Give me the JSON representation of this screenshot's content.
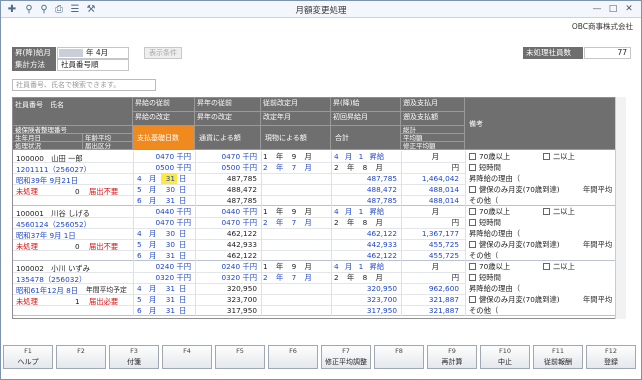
{
  "window": {
    "title": "月額変更処理",
    "company": "OBC商事株式会社"
  },
  "toolbar": {
    "icons": [
      "add-person-icon",
      "search-icon",
      "zoom-icon",
      "print-icon",
      "list-icon",
      "tools-icon"
    ]
  },
  "filters": {
    "month_label": "昇(降)給月",
    "month_value": "年 4月",
    "method_label": "集計方法",
    "method_value": "社員番号順",
    "display_button": "表示条件",
    "unprocessed_label": "未処理社員数",
    "unprocessed_value": "77"
  },
  "search": {
    "placeholder": "社員番号、氏名で検索できます。"
  },
  "table_header": {
    "emp_no": "社員番号",
    "name": "氏名",
    "insured_no": "被保険者整理番号",
    "birth": "生年月日",
    "status": "処理状況",
    "age": "年齢平均",
    "sep": "届出区分",
    "pay_before": "昇給の従前",
    "pay_after": "昇給の改定",
    "std_before": "昇年の従前",
    "std_after": "昇年の改定",
    "period_before": "従前改定月",
    "period_after": "改定年月",
    "raise_month": "昇(降)給",
    "raise_diff": "初回昇給月",
    "retro_pay": "遡及支払月",
    "retro_diff": "遡及支払額",
    "total": "総計",
    "avg": "平均額",
    "corrected": "修正平均額",
    "notes": "備考",
    "pay_days": "支払基礎日数",
    "by_pay": "通貨による額",
    "by_goods": "現物による額",
    "sum": "合計"
  },
  "employees": [
    {
      "emp_no": "100000",
      "name": "山田 一郎",
      "insured": "1201111（256027）",
      "birth": "昭和39年 9月21日",
      "status": "未処理",
      "status_num": "0",
      "notify": "届出不要",
      "age_avg": "",
      "pay_before": "0470 千円",
      "pay_after": "0500 千円",
      "std_before": "0470 千円",
      "std_after": "0500 千円",
      "prev_rev": [
        "1",
        "年",
        "9",
        "月"
      ],
      "new_rev": [
        "2",
        "年",
        "7",
        "月"
      ],
      "raise": [
        "4",
        "月",
        "1",
        "昇給"
      ],
      "first": [
        "2",
        "年",
        "8",
        "月"
      ],
      "retro": "月",
      "retro_amt": "円",
      "months": [
        {
          "m": "4",
          "d": "31",
          "cash": "487,785",
          "goods": "",
          "sum": "487,785",
          "total": "1,464,042"
        },
        {
          "m": "5",
          "d": "30",
          "cash": "488,472",
          "goods": "",
          "sum": "488,472",
          "total": "488,014"
        },
        {
          "m": "6",
          "d": "31",
          "cash": "487,785",
          "goods": "",
          "sum": "487,785",
          "total": "488,014"
        }
      ],
      "notes": [
        "70歳以上",
        "二以上",
        "短時間",
        "昇降給の理由（",
        "健保のみ月変(70歳到達)",
        "その他（"
      ],
      "notes_right": [
        "年間平均"
      ]
    },
    {
      "emp_no": "100001",
      "name": "川谷 しげる",
      "insured": "4560124（256052）",
      "birth": "昭和37年 9月 1日",
      "status": "未処理",
      "status_num": "0",
      "notify": "届出不要",
      "age_avg": "",
      "pay_before": "0440 千円",
      "pay_after": "0470 千円",
      "std_before": "0440 千円",
      "std_after": "0470 千円",
      "prev_rev": [
        "1",
        "年",
        "9",
        "月"
      ],
      "new_rev": [
        "2",
        "年",
        "7",
        "月"
      ],
      "raise": [
        "4",
        "月",
        "1",
        "昇給"
      ],
      "first": [
        "2",
        "年",
        "8",
        "月"
      ],
      "retro": "月",
      "retro_amt": "円",
      "months": [
        {
          "m": "4",
          "d": "30",
          "cash": "462,122",
          "goods": "",
          "sum": "462,122",
          "total": "1,367,177"
        },
        {
          "m": "5",
          "d": "30",
          "cash": "442,933",
          "goods": "",
          "sum": "442,933",
          "total": "455,725"
        },
        {
          "m": "6",
          "d": "31",
          "cash": "462,122",
          "goods": "",
          "sum": "462,122",
          "total": "455,725"
        }
      ],
      "notes": [
        "70歳以上",
        "二以上",
        "短時間",
        "昇降給の理由（",
        "健保のみ月変(70歳到達)",
        "その他（"
      ],
      "notes_right": [
        "年間平均"
      ]
    },
    {
      "emp_no": "100002",
      "name": "小川 いずみ",
      "insured": "135478（256032）",
      "birth": "昭和61年12月 8日",
      "status": "未処理",
      "status_num": "1",
      "notify": "届出必要",
      "age_avg": "年間平均予定",
      "pay_before": "0240 千円",
      "pay_after": "0320 千円",
      "std_before": "0240 千円",
      "std_after": "0320 千円",
      "prev_rev": [
        "1",
        "年",
        "9",
        "月"
      ],
      "new_rev": [
        "2",
        "年",
        "7",
        "月"
      ],
      "raise": [
        "4",
        "月",
        "1",
        "昇給"
      ],
      "first": [
        "2",
        "年",
        "8",
        "月"
      ],
      "retro": "月",
      "retro_amt": "円",
      "months": [
        {
          "m": "4",
          "d": "31",
          "cash": "320,950",
          "goods": "",
          "sum": "320,950",
          "total": "962,600"
        },
        {
          "m": "5",
          "d": "31",
          "cash": "323,700",
          "goods": "",
          "sum": "323,700",
          "total": "321,887"
        },
        {
          "m": "6",
          "d": "31",
          "cash": "317,950",
          "goods": "",
          "sum": "317,950",
          "total": "321,887"
        }
      ],
      "notes": [
        "70歳以上",
        "二以上",
        "短時間",
        "昇降給の理由（",
        "健保のみ月変(70歳到達)",
        "その他（"
      ],
      "notes_right": [
        "年間平均"
      ]
    }
  ],
  "fkeys": [
    {
      "key": "F1",
      "label": "ヘルプ"
    },
    {
      "key": "F2",
      "label": ""
    },
    {
      "key": "F3",
      "label": "付箋"
    },
    {
      "key": "F4",
      "label": ""
    },
    {
      "key": "F5",
      "label": ""
    },
    {
      "key": "F6",
      "label": ""
    },
    {
      "key": "F7",
      "label": "修正平均調整"
    },
    {
      "key": "F8",
      "label": ""
    },
    {
      "key": "F9",
      "label": "再計算"
    },
    {
      "key": "F10",
      "label": "中止"
    },
    {
      "key": "F11",
      "label": "従前報酬"
    },
    {
      "key": "F12",
      "label": "登録"
    }
  ]
}
